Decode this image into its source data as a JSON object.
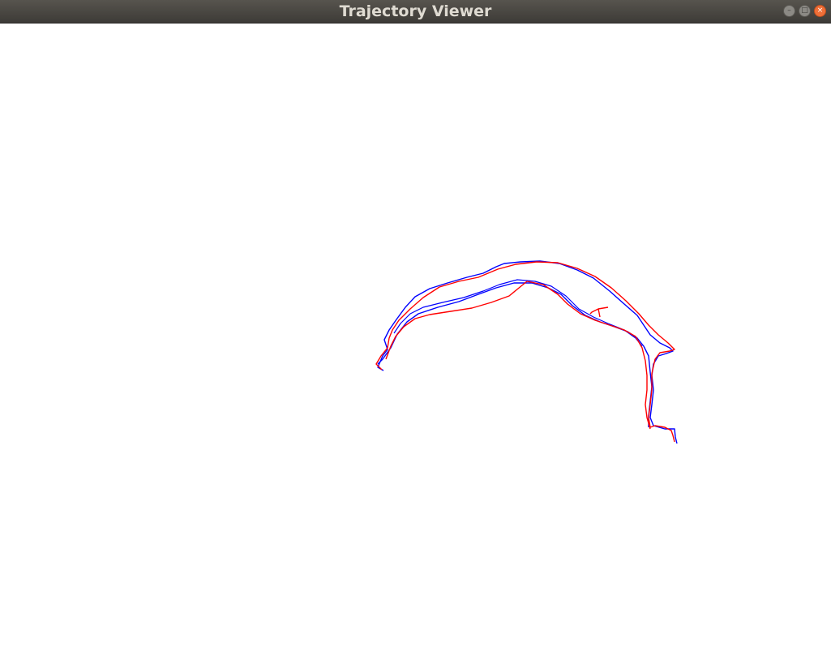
{
  "window": {
    "title": "Trajectory Viewer",
    "controls": {
      "minimize_icon": "minimize-icon",
      "maximize_icon": "maximize-icon",
      "close_icon": "close-icon",
      "minimize_glyph": "–",
      "maximize_glyph": "□",
      "close_glyph": "×"
    }
  },
  "viewer": {
    "background": "#ffffff",
    "trajectories": [
      {
        "color": "#0000ff"
      },
      {
        "color": "#ff0000"
      }
    ]
  }
}
